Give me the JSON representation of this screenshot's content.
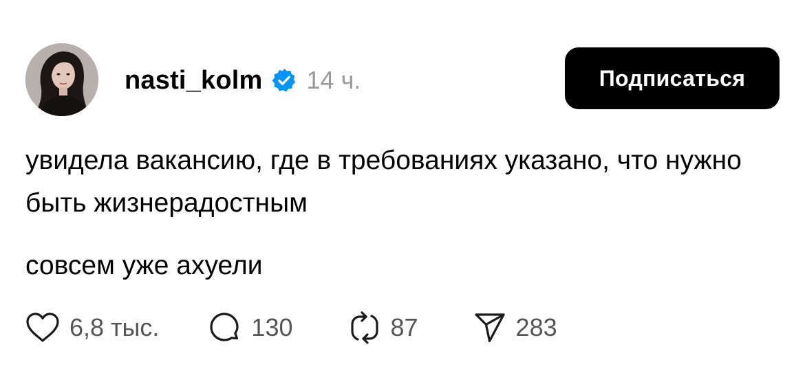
{
  "post": {
    "author": {
      "username": "nasti_kolm",
      "verified": true,
      "avatar_icon": "profile-photo"
    },
    "time": "14 ч.",
    "follow_label": "Подписаться",
    "paragraphs": [
      "увидела вакансию, где в требованиях указано, что нужно быть жизнерадостным",
      "совсем уже ахуели"
    ],
    "actions": {
      "likes": "6,8 тыс.",
      "comments": "130",
      "reposts": "87",
      "shares": "283"
    }
  },
  "colors": {
    "text": "#000000",
    "muted": "#999999",
    "counts": "#555555",
    "verified_badge": "#0095F6",
    "button_bg": "#000000",
    "button_text": "#FFFFFF"
  },
  "icons": {
    "like": "heart-icon",
    "comment": "speech-bubble-icon",
    "repost": "repost-arrows-icon",
    "share": "paper-plane-icon",
    "verified": "verified-badge-icon"
  }
}
